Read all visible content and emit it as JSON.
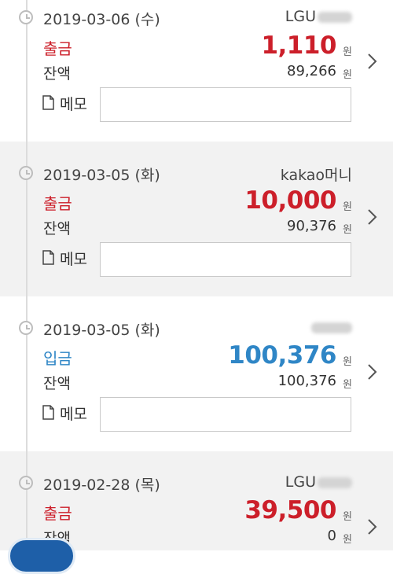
{
  "currency_unit": "원",
  "memo_label": "메모",
  "balance_label": "잔액",
  "colors": {
    "withdrawal": "#cc1f2a",
    "deposit": "#2f86c6"
  },
  "icons": [
    "clock-icon",
    "memo-icon",
    "chevron-right-icon"
  ],
  "transactions": [
    {
      "date": "2019-03-06 (수)",
      "merchant": "LGU",
      "type": "출금",
      "amount": "1,110",
      "balance": "89,266"
    },
    {
      "date": "2019-03-05 (화)",
      "merchant": "kakao머니",
      "type": "출금",
      "amount": "10,000",
      "balance": "90,376"
    },
    {
      "date": "2019-03-05 (화)",
      "merchant": "",
      "type": "입금",
      "amount": "100,376",
      "balance": "100,376"
    },
    {
      "date": "2019-02-28 (목)",
      "merchant": "LGU",
      "type": "출금",
      "amount": "39,500",
      "balance": "0"
    }
  ]
}
